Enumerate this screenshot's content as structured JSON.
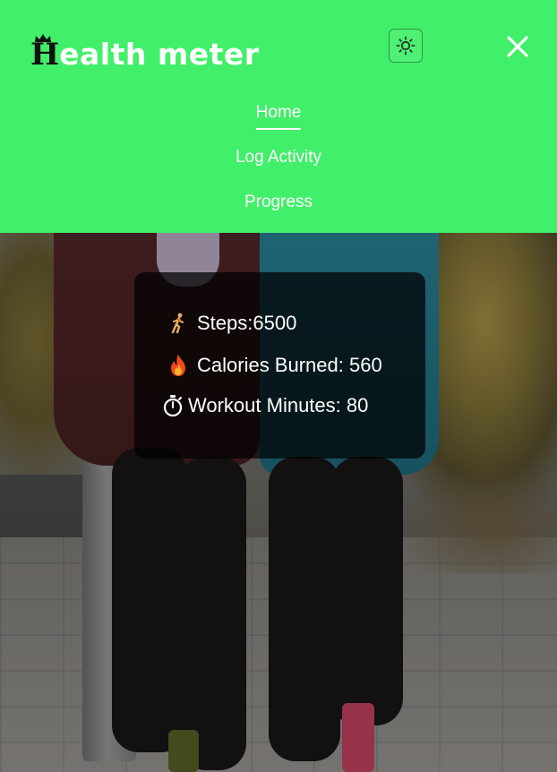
{
  "app": {
    "logo_initial": "H",
    "logo_rest": "ealth meter"
  },
  "header": {
    "theme_toggle_icon": "sun-icon",
    "close_icon": "close-icon",
    "background_color": "#42ef6a"
  },
  "nav": {
    "items": [
      {
        "label": "Home",
        "active": true
      },
      {
        "label": "Log Activity",
        "active": false
      },
      {
        "label": "Progress",
        "active": false
      }
    ]
  },
  "stats": {
    "steps": {
      "icon": "runner-icon",
      "label": "Steps:6500"
    },
    "calories": {
      "icon": "fire-icon",
      "label": "Calories Burned: 560"
    },
    "workout": {
      "icon": "stopwatch-icon",
      "label": "Workout Minutes: 80"
    }
  }
}
